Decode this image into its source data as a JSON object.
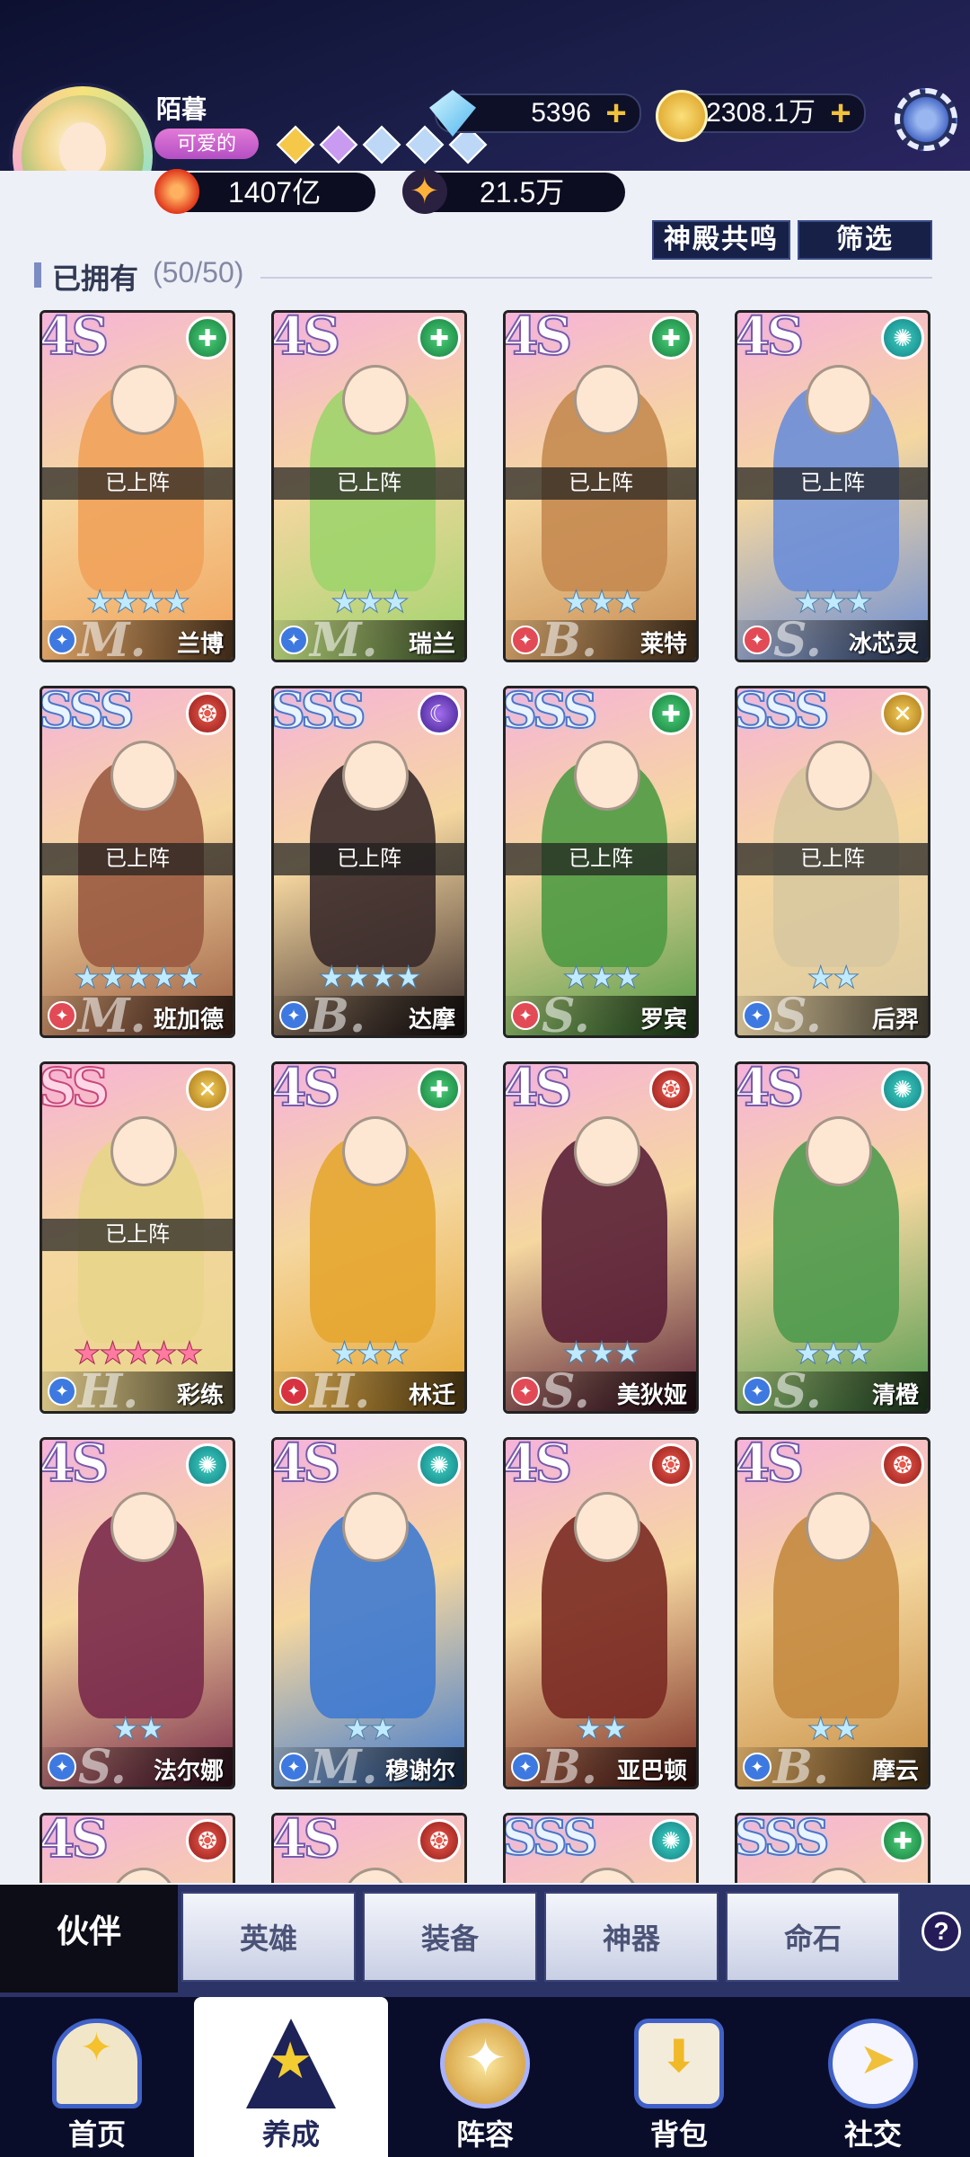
{
  "header": {
    "username": "陌暮",
    "title_badge": "可爱的",
    "gems": [
      "gold-star",
      "violet-star",
      "silver-star",
      "silver-star",
      "silver-diamond"
    ],
    "diamonds": "5396",
    "gold": "2308.1万",
    "power": "1407亿",
    "star_currency": "21.5万",
    "settings_icon": "gear-icon"
  },
  "actions": {
    "resonance": "神殿共鸣",
    "filter": "筛选"
  },
  "section": {
    "label": "已拥有",
    "count": "(50/50)"
  },
  "deployed_label": "已上阵",
  "cards": [
    {
      "rank": "4S",
      "rank_style": "4s",
      "element": "green",
      "name": "兰博",
      "grade": "M.",
      "stars": 4,
      "deployed": true,
      "job": "blue",
      "art": "#f1a25a"
    },
    {
      "rank": "4S",
      "rank_style": "4s",
      "element": "green",
      "name": "瑞兰",
      "grade": "M.",
      "stars": 3,
      "deployed": true,
      "job": "blue",
      "art": "#9fd46c"
    },
    {
      "rank": "4S",
      "rank_style": "4s",
      "element": "green",
      "name": "莱特",
      "grade": "B.",
      "stars": 3,
      "deployed": true,
      "job": "red",
      "art": "#c58a50"
    },
    {
      "rank": "4S",
      "rank_style": "4s",
      "element": "teal",
      "name": "冰芯灵",
      "grade": "S.",
      "stars": 3,
      "deployed": true,
      "job": "red",
      "art": "#6b8ed8"
    },
    {
      "rank": "SSS",
      "rank_style": "sss",
      "element": "red",
      "name": "班加德",
      "grade": "M.",
      "stars": 5,
      "deployed": true,
      "job": "red",
      "art": "#9a5a40"
    },
    {
      "rank": "SSS",
      "rank_style": "sss",
      "element": "purple",
      "name": "达摩",
      "grade": "B.",
      "stars": 4,
      "deployed": true,
      "job": "blue",
      "art": "#3a2a2a"
    },
    {
      "rank": "SSS",
      "rank_style": "sss",
      "element": "green",
      "name": "罗宾",
      "grade": "S.",
      "stars": 3,
      "deployed": true,
      "job": "red",
      "art": "#4f9a44"
    },
    {
      "rank": "SSS",
      "rank_style": "sss",
      "element": "gold",
      "name": "后羿",
      "grade": "S.",
      "stars": 2,
      "deployed": true,
      "job": "blue",
      "art": "#d8c8a0"
    },
    {
      "rank": "SS",
      "rank_style": "ss",
      "element": "gold",
      "name": "彩练",
      "grade": "H.",
      "stars": 5,
      "deployed": true,
      "job": "blue",
      "art": "#e8d58a",
      "stars_pink": true
    },
    {
      "rank": "4S",
      "rank_style": "4s",
      "element": "green",
      "name": "林迁",
      "grade": "H.",
      "stars": 3,
      "deployed": false,
      "job": "crimson",
      "art": "#e6a630"
    },
    {
      "rank": "4S",
      "rank_style": "4s",
      "element": "red",
      "name": "美狄娅",
      "grade": "S.",
      "stars": 3,
      "deployed": false,
      "job": "red",
      "art": "#5a2036"
    },
    {
      "rank": "4S",
      "rank_style": "4s",
      "element": "teal",
      "name": "清橙",
      "grade": "S.",
      "stars": 3,
      "deployed": false,
      "job": "blue",
      "art": "#4f9a4e"
    },
    {
      "rank": "4S",
      "rank_style": "4s",
      "element": "teal",
      "name": "法尔娜",
      "grade": "S.",
      "stars": 2,
      "deployed": false,
      "job": "blue",
      "art": "#7a2a4a"
    },
    {
      "rank": "4S",
      "rank_style": "4s",
      "element": "teal",
      "name": "穆谢尔",
      "grade": "M.",
      "stars": 2,
      "deployed": false,
      "job": "blue",
      "art": "#3f7ad0"
    },
    {
      "rank": "4S",
      "rank_style": "4s",
      "element": "red",
      "name": "亚巴顿",
      "grade": "B.",
      "stars": 2,
      "deployed": false,
      "job": "blue",
      "art": "#7a2a22"
    },
    {
      "rank": "4S",
      "rank_style": "4s",
      "element": "red",
      "name": "摩云",
      "grade": "B.",
      "stars": 2,
      "deployed": false,
      "job": "blue",
      "art": "#c48a40"
    },
    {
      "rank": "4S",
      "rank_style": "4s",
      "element": "red",
      "art": "#d26a4a"
    },
    {
      "rank": "4S",
      "rank_style": "4s",
      "element": "red",
      "art": "#e07060"
    },
    {
      "rank": "SSS",
      "rank_style": "sss",
      "element": "teal",
      "art": "#f0d070"
    },
    {
      "rank": "SSS",
      "rank_style": "sss",
      "element": "green",
      "art": "#e08aa0"
    }
  ],
  "subtabs": {
    "active": "伙伴",
    "items": [
      "英雄",
      "装备",
      "神器",
      "命石"
    ],
    "help": "?"
  },
  "nav": {
    "items": [
      "首页",
      "养成",
      "阵容",
      "背包",
      "社交"
    ],
    "active_index": 1,
    "icons": [
      "home-icon",
      "train-icon",
      "lineup-icon",
      "bag-icon",
      "social-icon"
    ]
  }
}
